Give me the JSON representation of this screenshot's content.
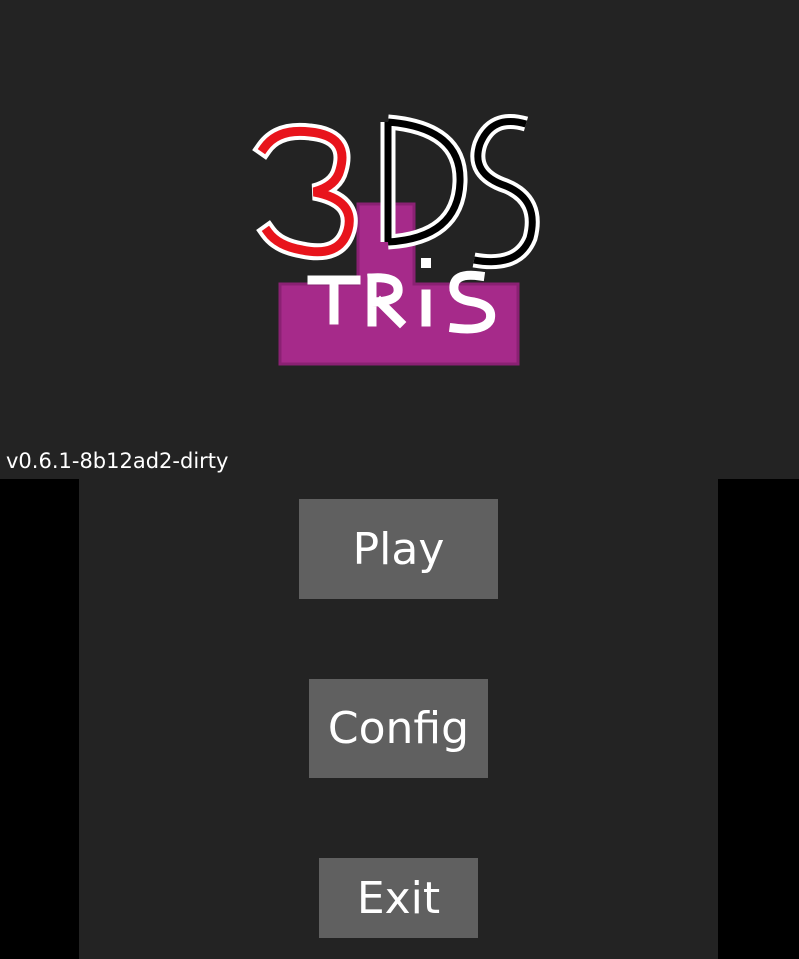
{
  "logo": {
    "text_3": "3",
    "text_ds": "DS",
    "text_tris": "TRiS",
    "colors": {
      "three": "#e8141c",
      "ds": "#000000",
      "outline": "#ffffff",
      "plate": "#a62a8a",
      "plate_edge": "#7b1d66"
    }
  },
  "version": "v0.6.1-8b12ad2-dirty",
  "menu": {
    "play": "Play",
    "config": "Config",
    "exit": "Exit"
  },
  "colors": {
    "screen_bg": "#232323",
    "letterbox": "#000000",
    "button_bg": "#606060",
    "button_text": "#ffffff"
  }
}
